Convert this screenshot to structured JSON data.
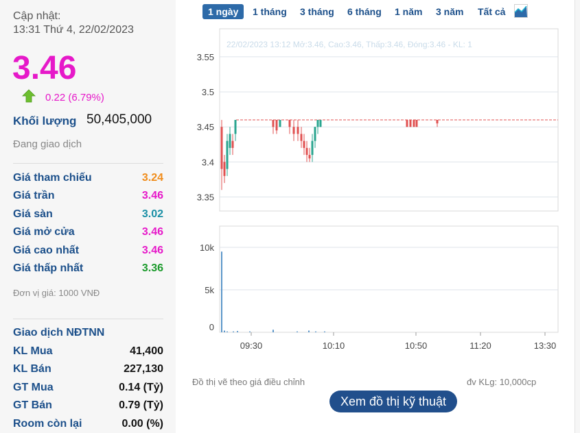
{
  "sidebar": {
    "update_label": "Cập nhật:",
    "update_time": "13:31 Thứ 4, 22/02/2023",
    "price": "3.46",
    "change": "0.22 (6.79%)",
    "volume_label": "Khối lượng",
    "volume_value": "50,405,000",
    "status": "Đang giao dịch",
    "prices": [
      {
        "label": "Giá tham chiếu",
        "value": "3.24",
        "color": "#f08c1a"
      },
      {
        "label": "Giá trần",
        "value": "3.46",
        "color": "#e619c9"
      },
      {
        "label": "Giá sàn",
        "value": "3.02",
        "color": "#1a8fa5"
      },
      {
        "label": "Giá mở cửa",
        "value": "3.46",
        "color": "#e619c9"
      },
      {
        "label": "Giá cao nhất",
        "value": "3.46",
        "color": "#e619c9"
      },
      {
        "label": "Giá thấp nhất",
        "value": "3.36",
        "color": "#1a9a2a"
      }
    ],
    "unit_note": "Đơn vị giá: 1000 VNĐ",
    "foreign_title": "Giao dịch NĐTNN",
    "foreign": [
      {
        "label": "KL Mua",
        "value": "41,400"
      },
      {
        "label": "KL Bán",
        "value": "227,130"
      },
      {
        "label": "GT Mua",
        "value": "0.14 (Tỷ)"
      },
      {
        "label": "GT Bán",
        "value": "0.79 (Tỷ)"
      },
      {
        "label": "Room còn lại",
        "value": "0.00 (%)"
      }
    ]
  },
  "tabs": [
    "1 ngày",
    "1 tháng",
    "3 tháng",
    "6 tháng",
    "1 năm",
    "3 năm",
    "Tất cả"
  ],
  "active_tab": "1 ngày",
  "chart_icon": "area-chart-icon",
  "chart_data": {
    "type": "candlestick",
    "tooltip": "22/02/2023 13:12 Mở:3.46, Cao:3.46, Thấp:3.46, Đóng:3.46 - KL: 1",
    "price_ticks": [
      "3.55",
      "3.5",
      "3.45",
      "3.4",
      "3.35"
    ],
    "price_tick_values": [
      3.55,
      3.5,
      3.45,
      3.4,
      3.35
    ],
    "volume_ticks": [
      "10k",
      "5k",
      "0"
    ],
    "volume_tick_values": [
      10000,
      5000,
      0
    ],
    "time_ticks": [
      "09:30",
      "10:10",
      "10:50",
      "11:20",
      "13:30"
    ],
    "price_ylim": [
      3.33,
      3.59
    ],
    "reference_line": 3.46,
    "up_color": "#2aa58f",
    "down_color": "#e05050",
    "volume_series": [
      9500,
      200,
      100,
      100,
      150,
      100,
      300,
      100,
      200,
      100,
      100
    ]
  },
  "footnote_left": "Đồ thị vẽ theo giá điều chỉnh",
  "footnote_right": "đv KLg: 10,000cp",
  "tech_button": "Xem đồ thị kỹ thuật"
}
